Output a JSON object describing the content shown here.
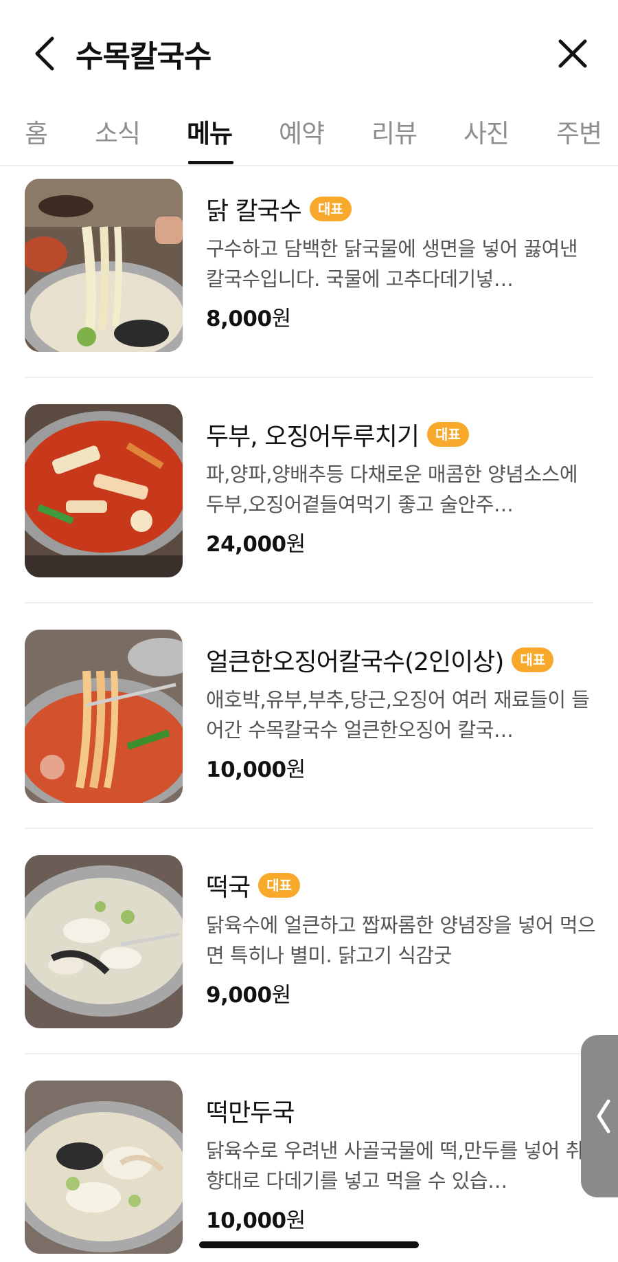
{
  "header": {
    "title": "수목칼국수",
    "back_icon": "chevron-left-icon",
    "close_icon": "close-icon"
  },
  "tabs": [
    {
      "label": "홈",
      "active": false
    },
    {
      "label": "소식",
      "active": false
    },
    {
      "label": "메뉴",
      "active": true
    },
    {
      "label": "예약",
      "active": false
    },
    {
      "label": "리뷰",
      "active": false
    },
    {
      "label": "사진",
      "active": false
    },
    {
      "label": "주변",
      "active": false
    }
  ],
  "menu": [
    {
      "name": "닭 칼국수",
      "badge": "대표",
      "description": "구수하고 담백한 닭국물에 생면을 넣어 끓여낸 칼국수입니다. 국물에 고추다데기넣…",
      "price_number": "8,000",
      "price_unit": "원"
    },
    {
      "name": "두부, 오징어두루치기",
      "badge": "대표",
      "description": "파,양파,양배추등 다채로운 매콤한 양념소스에 두부,오징어곁들여먹기 좋고 술안주…",
      "price_number": "24,000",
      "price_unit": "원"
    },
    {
      "name": "얼큰한오징어칼국수(2인이상)",
      "badge": "대표",
      "description": "애호박,유부,부추,당근,오징어 여러 재료들이 들어간 수목칼국수 얼큰한오징어 칼국…",
      "price_number": "10,000",
      "price_unit": "원"
    },
    {
      "name": "떡국",
      "badge": "대표",
      "description": "닭육수에 얼큰하고 짭짜롬한 양념장을 넣어 먹으면 특히나 별미. 닭고기 식감굿",
      "price_number": "9,000",
      "price_unit": "원"
    },
    {
      "name": "떡만두국",
      "badge": "",
      "description": "닭육수로 우려낸 사골국물에 떡,만두를 넣어 취향대로 다데기를 넣고 먹을 수 있습…",
      "price_number": "10,000",
      "price_unit": "원"
    }
  ],
  "colors": {
    "badge": "#f8a82b",
    "active_tab": "#111111",
    "inactive_tab": "#8e8e8e",
    "description": "#555555"
  }
}
